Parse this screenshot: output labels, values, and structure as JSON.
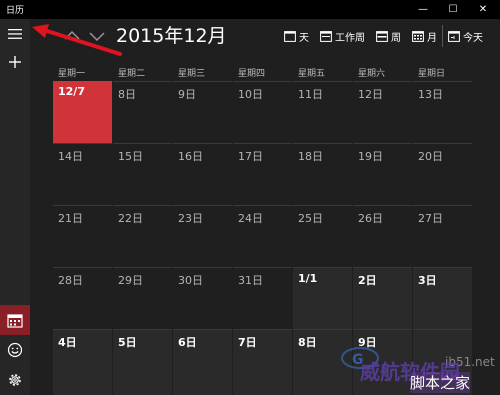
{
  "window": {
    "title": "日历",
    "minimize": "—",
    "maximize": "☐",
    "close": "✕"
  },
  "sidebar": {
    "menu_icon": "hamburger-menu-icon",
    "add_icon": "plus-icon",
    "calendar_icon": "calendar-icon",
    "emoji_icon": "smiley-icon",
    "settings_icon": "gear-icon"
  },
  "header": {
    "month_title": "2015年12月",
    "views": {
      "day": "天",
      "workweek": "工作周",
      "week": "周",
      "month": "月",
      "today": "今天"
    }
  },
  "weekdays": [
    "星期一",
    "星期二",
    "星期三",
    "星期四",
    "星期五",
    "星期六",
    "星期日"
  ],
  "weeks": [
    [
      {
        "label": "12/7",
        "state": "today"
      },
      {
        "label": "8日",
        "state": "current"
      },
      {
        "label": "9日",
        "state": "current"
      },
      {
        "label": "10日",
        "state": "current"
      },
      {
        "label": "11日",
        "state": "current"
      },
      {
        "label": "12日",
        "state": "current"
      },
      {
        "label": "13日",
        "state": "current"
      }
    ],
    [
      {
        "label": "14日",
        "state": "current"
      },
      {
        "label": "15日",
        "state": "current"
      },
      {
        "label": "16日",
        "state": "current"
      },
      {
        "label": "17日",
        "state": "current"
      },
      {
        "label": "18日",
        "state": "current"
      },
      {
        "label": "19日",
        "state": "current"
      },
      {
        "label": "20日",
        "state": "current"
      }
    ],
    [
      {
        "label": "21日",
        "state": "current"
      },
      {
        "label": "22日",
        "state": "current"
      },
      {
        "label": "23日",
        "state": "current"
      },
      {
        "label": "24日",
        "state": "current"
      },
      {
        "label": "25日",
        "state": "current"
      },
      {
        "label": "26日",
        "state": "current"
      },
      {
        "label": "27日",
        "state": "current"
      }
    ],
    [
      {
        "label": "28日",
        "state": "current"
      },
      {
        "label": "29日",
        "state": "current"
      },
      {
        "label": "30日",
        "state": "current"
      },
      {
        "label": "31日",
        "state": "current"
      },
      {
        "label": "1/1",
        "state": "next"
      },
      {
        "label": "2日",
        "state": "next"
      },
      {
        "label": "3日",
        "state": "next"
      }
    ],
    [
      {
        "label": "4日",
        "state": "next"
      },
      {
        "label": "5日",
        "state": "next"
      },
      {
        "label": "6日",
        "state": "next"
      },
      {
        "label": "7日",
        "state": "next"
      },
      {
        "label": "8日",
        "state": "next"
      },
      {
        "label": "9日",
        "state": "next"
      },
      {
        "label": "",
        "state": "next"
      }
    ]
  ],
  "watermark": {
    "text1": "威航软件园",
    "text2": "脚本之家",
    "url": "jb51.net"
  },
  "colors": {
    "today": "#d13438",
    "sidebar_selected": "#8b1f28",
    "annotation_arrow": "#e0141e"
  }
}
